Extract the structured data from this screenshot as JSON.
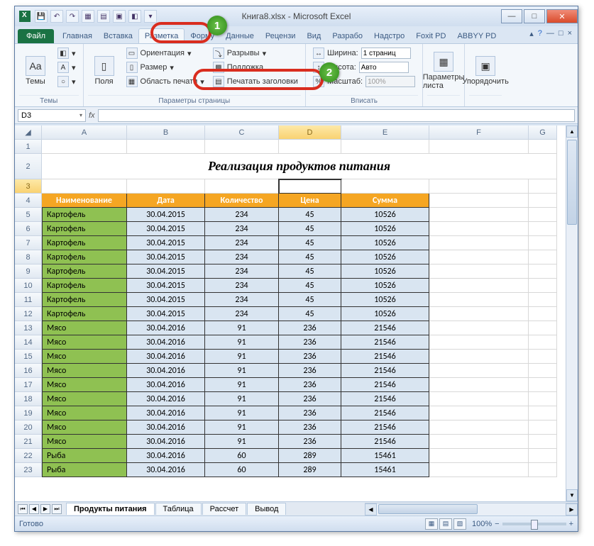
{
  "window": {
    "title_doc": "Книга8.xlsx",
    "title_app": "Microsoft Excel"
  },
  "ribbon": {
    "file": "Файл",
    "tabs": [
      "Главная",
      "Вставка",
      "Разметка",
      "Форму",
      "Данные",
      "Рецензи",
      "Вид",
      "Разрабо",
      "Надстро",
      "Foxit PD",
      "ABBYY PD"
    ],
    "active_tab": 2,
    "groups": {
      "themes": {
        "label": "Темы",
        "btn": "Темы"
      },
      "page_setup": {
        "label": "Параметры страницы",
        "fields": "Поля",
        "orientation": "Ориентация",
        "size": "Размер",
        "print_area": "Область печати",
        "breaks": "Разрывы",
        "background": "Подложка",
        "print_titles": "Печатать заголовки"
      },
      "fit": {
        "label": "Вписать",
        "width_lbl": "Ширина:",
        "width_val": "1 страниц",
        "height_lbl": "Высота:",
        "height_val": "Авто",
        "scale_lbl": "Масштаб:",
        "scale_val": "100%"
      },
      "sheet_options": {
        "label": "",
        "btn": "Параметры листа"
      },
      "arrange": {
        "label": "",
        "btn": "Упорядочить"
      }
    }
  },
  "formula": {
    "name_box": "D3",
    "fx": "fx"
  },
  "columns": [
    "A",
    "B",
    "C",
    "D",
    "E",
    "F",
    "G"
  ],
  "title_row": "Реализация продуктов питания",
  "headers": [
    "Наименование",
    "Дата",
    "Количество",
    "Цена",
    "Сумма"
  ],
  "rows": [
    {
      "r": 5,
      "name": "Картофель",
      "date": "30.04.2015",
      "qty": 234,
      "price": 45,
      "sum": 10526
    },
    {
      "r": 6,
      "name": "Картофель",
      "date": "30.04.2015",
      "qty": 234,
      "price": 45,
      "sum": 10526
    },
    {
      "r": 7,
      "name": "Картофель",
      "date": "30.04.2015",
      "qty": 234,
      "price": 45,
      "sum": 10526
    },
    {
      "r": 8,
      "name": "Картофель",
      "date": "30.04.2015",
      "qty": 234,
      "price": 45,
      "sum": 10526
    },
    {
      "r": 9,
      "name": "Картофель",
      "date": "30.04.2015",
      "qty": 234,
      "price": 45,
      "sum": 10526
    },
    {
      "r": 10,
      "name": "Картофель",
      "date": "30.04.2015",
      "qty": 234,
      "price": 45,
      "sum": 10526
    },
    {
      "r": 11,
      "name": "Картофель",
      "date": "30.04.2015",
      "qty": 234,
      "price": 45,
      "sum": 10526
    },
    {
      "r": 12,
      "name": "Картофель",
      "date": "30.04.2015",
      "qty": 234,
      "price": 45,
      "sum": 10526
    },
    {
      "r": 13,
      "name": "Мясо",
      "date": "30.04.2016",
      "qty": 91,
      "price": 236,
      "sum": 21546
    },
    {
      "r": 14,
      "name": "Мясо",
      "date": "30.04.2016",
      "qty": 91,
      "price": 236,
      "sum": 21546
    },
    {
      "r": 15,
      "name": "Мясо",
      "date": "30.04.2016",
      "qty": 91,
      "price": 236,
      "sum": 21546
    },
    {
      "r": 16,
      "name": "Мясо",
      "date": "30.04.2016",
      "qty": 91,
      "price": 236,
      "sum": 21546
    },
    {
      "r": 17,
      "name": "Мясо",
      "date": "30.04.2016",
      "qty": 91,
      "price": 236,
      "sum": 21546
    },
    {
      "r": 18,
      "name": "Мясо",
      "date": "30.04.2016",
      "qty": 91,
      "price": 236,
      "sum": 21546
    },
    {
      "r": 19,
      "name": "Мясо",
      "date": "30.04.2016",
      "qty": 91,
      "price": 236,
      "sum": 21546
    },
    {
      "r": 20,
      "name": "Мясо",
      "date": "30.04.2016",
      "qty": 91,
      "price": 236,
      "sum": 21546
    },
    {
      "r": 21,
      "name": "Мясо",
      "date": "30.04.2016",
      "qty": 91,
      "price": 236,
      "sum": 21546
    },
    {
      "r": 22,
      "name": "Рыба",
      "date": "30.04.2016",
      "qty": 60,
      "price": 289,
      "sum": 15461
    },
    {
      "r": 23,
      "name": "Рыба",
      "date": "30.04.2016",
      "qty": 60,
      "price": 289,
      "sum": 15461
    }
  ],
  "sheet_tabs": [
    "Продукты питания",
    "Таблица",
    "Рассчет",
    "Вывод"
  ],
  "status": {
    "ready": "Готово",
    "zoom": "100%"
  },
  "callouts": {
    "c1": "1",
    "c2": "2"
  }
}
